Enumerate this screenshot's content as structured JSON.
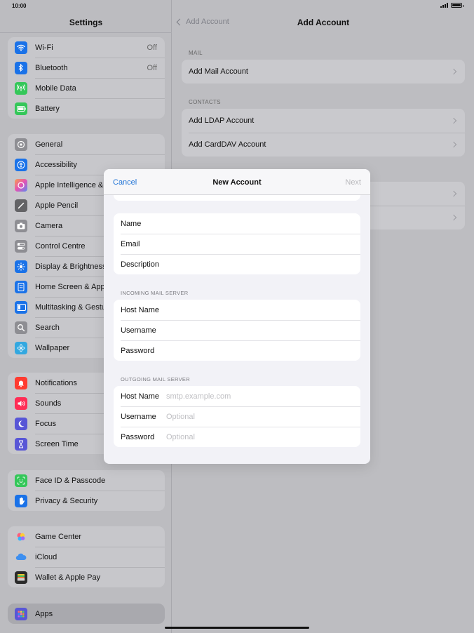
{
  "status": {
    "time": "10:00"
  },
  "sidebar": {
    "title": "Settings",
    "groups": [
      {
        "items": [
          {
            "label": "Wi-Fi",
            "value": "Off",
            "icon": "wifi-icon",
            "color": "#1a72e8"
          },
          {
            "label": "Bluetooth",
            "value": "Off",
            "icon": "bluetooth-icon",
            "color": "#1a72e8"
          },
          {
            "label": "Mobile Data",
            "value": "",
            "icon": "antenna-icon",
            "color": "#34c759"
          },
          {
            "label": "Battery",
            "value": "",
            "icon": "battery-icon",
            "color": "#34c759"
          }
        ]
      },
      {
        "items": [
          {
            "label": "General",
            "icon": "gear-icon",
            "color": "#8e8e93"
          },
          {
            "label": "Accessibility",
            "icon": "accessibility-icon",
            "color": "#1a72e8"
          },
          {
            "label": "Apple Intelligence & Siri",
            "icon": "siri-icon",
            "color": "#c86dd7"
          },
          {
            "label": "Apple Pencil",
            "icon": "pencil-icon",
            "color": "#636366"
          },
          {
            "label": "Camera",
            "icon": "camera-icon",
            "color": "#8e8e93"
          },
          {
            "label": "Control Centre",
            "icon": "toggles-icon",
            "color": "#8e8e93"
          },
          {
            "label": "Display & Brightness",
            "icon": "sun-icon",
            "color": "#1a72e8"
          },
          {
            "label": "Home Screen & App Library",
            "icon": "home-screen-icon",
            "color": "#1a72e8"
          },
          {
            "label": "Multitasking & Gestures",
            "icon": "multitasking-icon",
            "color": "#1a72e8"
          },
          {
            "label": "Search",
            "icon": "search-icon",
            "color": "#8e8e93"
          },
          {
            "label": "Wallpaper",
            "icon": "flower-icon",
            "color": "#33a8e0"
          }
        ]
      },
      {
        "items": [
          {
            "label": "Notifications",
            "icon": "bell-icon",
            "color": "#ff3b30"
          },
          {
            "label": "Sounds",
            "icon": "speaker-icon",
            "color": "#ff2d55"
          },
          {
            "label": "Focus",
            "icon": "moon-icon",
            "color": "#5856d6"
          },
          {
            "label": "Screen Time",
            "icon": "hourglass-icon",
            "color": "#5856d6"
          }
        ]
      },
      {
        "items": [
          {
            "label": "Face ID & Passcode",
            "icon": "face-id-icon",
            "color": "#34c759"
          },
          {
            "label": "Privacy & Security",
            "icon": "hand-icon",
            "color": "#1a72e8"
          }
        ]
      },
      {
        "items": [
          {
            "label": "Game Center",
            "icon": "game-center-icon",
            "color": "#ffffff"
          },
          {
            "label": "iCloud",
            "icon": "cloud-icon",
            "color": "#ffffff"
          },
          {
            "label": "Wallet & Apple Pay",
            "icon": "wallet-icon",
            "color": "#2b2b2b"
          }
        ]
      },
      {
        "items": [
          {
            "label": "Apps",
            "icon": "apps-grid-icon",
            "color": "#5856d6"
          }
        ]
      }
    ]
  },
  "pane": {
    "back_label": "Add Account",
    "title": "Add Account",
    "mail_section": "MAIL",
    "mail_items": [
      "Add Mail Account"
    ],
    "contacts_section": "CONTACTS",
    "contacts_items": [
      "Add LDAP Account",
      "Add CardDAV Account"
    ]
  },
  "modal": {
    "cancel": "Cancel",
    "title": "New Account",
    "next": "Next",
    "account_fields": [
      "Name",
      "Email",
      "Description"
    ],
    "incoming_section": "INCOMING MAIL SERVER",
    "incoming_fields": [
      "Host Name",
      "Username",
      "Password"
    ],
    "outgoing_section": "OUTGOING MAIL SERVER",
    "outgoing_fields": [
      {
        "label": "Host Name",
        "placeholder": "smtp.example.com"
      },
      {
        "label": "Username",
        "placeholder": "Optional"
      },
      {
        "label": "Password",
        "placeholder": "Optional"
      }
    ]
  }
}
